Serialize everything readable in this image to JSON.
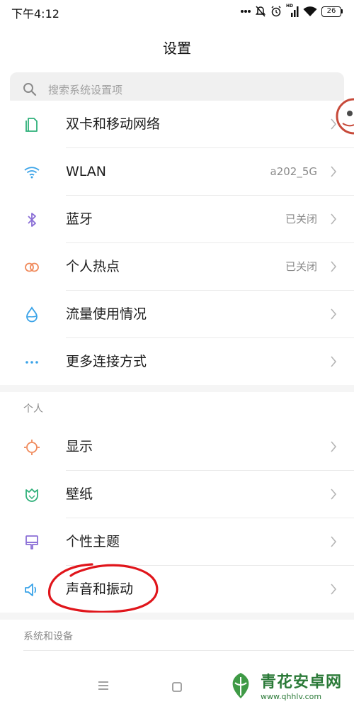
{
  "status_bar": {
    "time": "下午4:12",
    "network_badge": "HD",
    "battery_level": "26"
  },
  "header": {
    "title": "设置"
  },
  "search": {
    "placeholder": "搜索系统设置项"
  },
  "network_section": {
    "items": [
      {
        "label": "双卡和移动网络",
        "value": "",
        "icon": "sim-card-icon",
        "color": "#2fb07a"
      },
      {
        "label": "WLAN",
        "value": "a202_5G",
        "icon": "wifi-icon",
        "color": "#3aa3e8"
      },
      {
        "label": "蓝牙",
        "value": "已关闭",
        "icon": "bluetooth-icon",
        "color": "#8b6fd6"
      },
      {
        "label": "个人热点",
        "value": "已关闭",
        "icon": "hotspot-icon",
        "color": "#f0895a"
      },
      {
        "label": "流量使用情况",
        "value": "",
        "icon": "data-usage-icon",
        "color": "#3aa3e8"
      },
      {
        "label": "更多连接方式",
        "value": "",
        "icon": "more-connections-icon",
        "color": "#3aa3e8"
      }
    ]
  },
  "personal_section": {
    "header": "个人",
    "items": [
      {
        "label": "显示",
        "value": "",
        "icon": "display-icon",
        "color": "#f0895a"
      },
      {
        "label": "壁纸",
        "value": "",
        "icon": "wallpaper-icon",
        "color": "#2fb07a"
      },
      {
        "label": "个性主题",
        "value": "",
        "icon": "theme-icon",
        "color": "#8b6fd6"
      },
      {
        "label": "声音和振动",
        "value": "",
        "icon": "sound-icon",
        "color": "#3aa3e8"
      }
    ]
  },
  "system_section": {
    "header": "系统和设备"
  },
  "watermark": {
    "title": "青花安卓网",
    "url": "www.qhhlv.com"
  },
  "annotation_color": "#e0151b"
}
